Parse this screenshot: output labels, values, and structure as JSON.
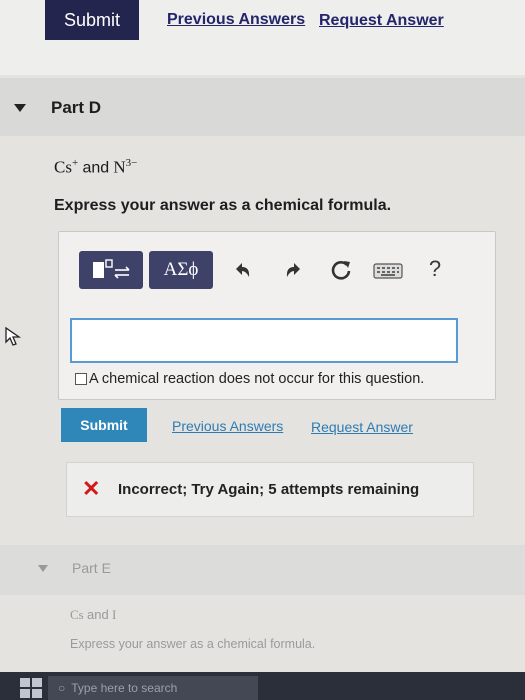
{
  "top_bar": {
    "submit_label": "Submit",
    "previous_answers_label": "Previous Answers",
    "request_answer_label": "Request Answer"
  },
  "part_d": {
    "title": "Part D",
    "question": {
      "ion1": "Cs",
      "ion1_charge": "+",
      "conjunction": "and",
      "ion2": "N",
      "ion2_charge": "3−"
    },
    "instruction": "Express your answer as a chemical formula.",
    "toolbar": {
      "templates_icon": "templates-icon",
      "greek_label": "ΑΣϕ",
      "undo_icon": "undo-icon",
      "redo_icon": "redo-icon",
      "reset_icon": "reset-icon",
      "keyboard_icon": "keyboard-icon",
      "help_label": "?"
    },
    "answer_value": "",
    "no_reaction_label": "A chemical reaction does not occur for this question.",
    "submit_label": "Submit",
    "previous_answers_label": "Previous Answers",
    "request_answer_label": "Request Answer",
    "feedback": {
      "status_icon": "x-icon",
      "text": "Incorrect; Try Again; 5 attempts remaining"
    }
  },
  "part_e": {
    "title": "Part E",
    "question": {
      "ion1": "Cs",
      "conjunction": "and",
      "ion2": "I"
    },
    "instruction": "Express your answer as a chemical formula."
  },
  "taskbar": {
    "search_placeholder": "Type here to search"
  },
  "colors": {
    "submit_dark": "#24254f",
    "submit_blue": "#2f87b9",
    "link_blue": "#2e7bb2",
    "answer_border": "#5a9ad3",
    "incorrect_red": "#d01a1a"
  }
}
